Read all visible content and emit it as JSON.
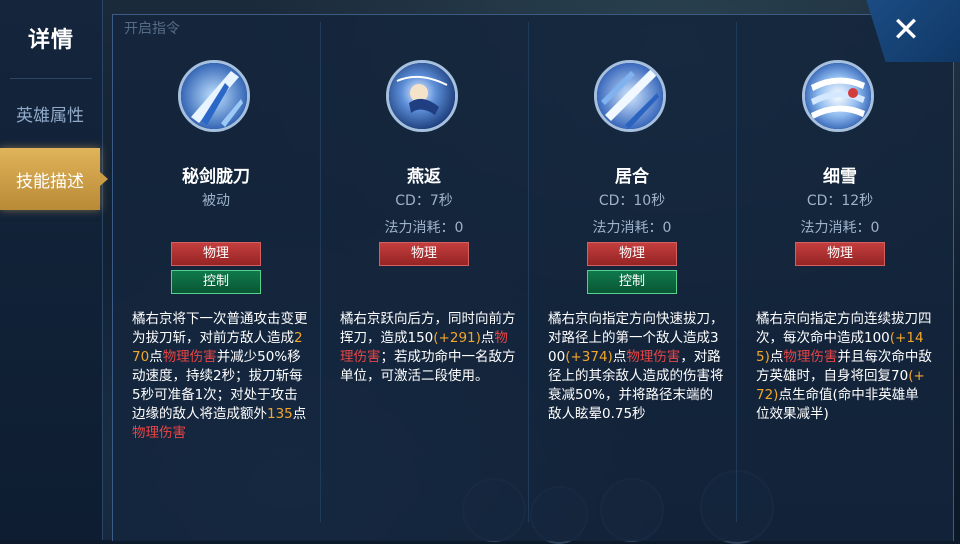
{
  "sidebar": {
    "title": "详情",
    "items": [
      {
        "label": "英雄属性"
      },
      {
        "label": "技能描述"
      }
    ]
  },
  "top_hint": "开启指令",
  "close": {
    "label": "✕"
  },
  "skills": [
    {
      "name": "秘剑胧刀",
      "line2": "被动",
      "line3": "",
      "tags": [
        "物理",
        "控制"
      ],
      "desc": [
        {
          "t": "橘右京将下一次普通攻击变更为拔刀斩，对前方敌人造成"
        },
        {
          "t": "270",
          "c": "o"
        },
        {
          "t": "点"
        },
        {
          "t": "物理伤害",
          "c": "r"
        },
        {
          "t": "并减少50%移动速度，持续2秒；拔刀斩每5秒可准备1次；对处于攻击边缘的敌人将造成额外"
        },
        {
          "t": "135",
          "c": "o"
        },
        {
          "t": "点"
        },
        {
          "t": "物理伤害",
          "c": "r"
        }
      ]
    },
    {
      "name": "燕返",
      "line2": "CD：7秒",
      "line3": "法力消耗：0",
      "tags": [
        "物理"
      ],
      "desc": [
        {
          "t": "橘右京跃向后方，同时向前方挥刀，造成150"
        },
        {
          "t": "(+291)",
          "c": "o"
        },
        {
          "t": "点"
        },
        {
          "t": "物理伤害",
          "c": "r"
        },
        {
          "t": "；若成功命中一名敌方单位，可激活二段使用。"
        }
      ]
    },
    {
      "name": "居合",
      "line2": "CD：10秒",
      "line3": "法力消耗：0",
      "tags": [
        "物理",
        "控制"
      ],
      "desc": [
        {
          "t": "橘右京向指定方向快速拔刀，对路径上的第一个敌人造成300"
        },
        {
          "t": "(+374)",
          "c": "o"
        },
        {
          "t": "点"
        },
        {
          "t": "物理伤害",
          "c": "r"
        },
        {
          "t": "，对路径上的其余敌人造成的伤害将衰减50%，并将路径末端的敌人眩晕0.75秒"
        }
      ]
    },
    {
      "name": "细雪",
      "line2": "CD：12秒",
      "line3": "法力消耗：0",
      "tags": [
        "物理"
      ],
      "desc": [
        {
          "t": "橘右京向指定方向连续拔刀四次，每次命中造成100"
        },
        {
          "t": "(+145)",
          "c": "o"
        },
        {
          "t": "点"
        },
        {
          "t": "物理伤害",
          "c": "r"
        },
        {
          "t": "并且每次命中敌方英雄时，自身将回复70"
        },
        {
          "t": "(+72)",
          "c": "o"
        },
        {
          "t": "点生命值(命中非英雄单位效果减半)"
        }
      ]
    }
  ],
  "colors": {
    "accent_gold": "#e0b45a",
    "damage_red": "#e84545",
    "value_orange": "#f2a62b",
    "tag_physical": "#b83333",
    "tag_control": "#0d6b42"
  }
}
